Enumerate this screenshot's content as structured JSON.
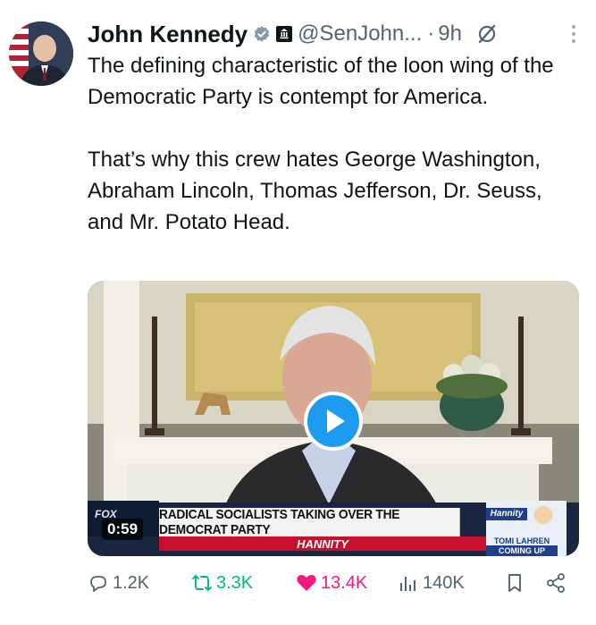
{
  "tweet": {
    "author_name": "John Kennedy",
    "handle": "@SenJohn...",
    "dot": "·",
    "time": "9h",
    "text": "The defining characteristic of the loon wing of the Democratic Party is contempt for America.\n\nThat’s why this crew hates George Washington, Abraham Lincoln, Thomas Jefferson, Dr. Seuss, and Mr. Potato Head.",
    "icons": {
      "verified": "verified-badge-icon",
      "government": "government-badge-icon",
      "grok": "grok-icon",
      "more": "more-options-icon"
    }
  },
  "media": {
    "duration": "0:59",
    "chyron": "RADICAL SOCIALISTS TAKING OVER THE DEMOCRAT PARTY",
    "show": "HANNITY",
    "promo_brand": "Hannity",
    "promo_name": "TOMI LAHREN",
    "promo_sub": "COMING UP",
    "icons": {
      "play": "play-icon"
    }
  },
  "actions": {
    "replies": "1.2K",
    "retweets": "3.3K",
    "likes": "13.4K",
    "views": "140K",
    "colors": {
      "retweet": "#00ba7c",
      "like": "#f91880",
      "accent": "#1d9bf0"
    }
  }
}
